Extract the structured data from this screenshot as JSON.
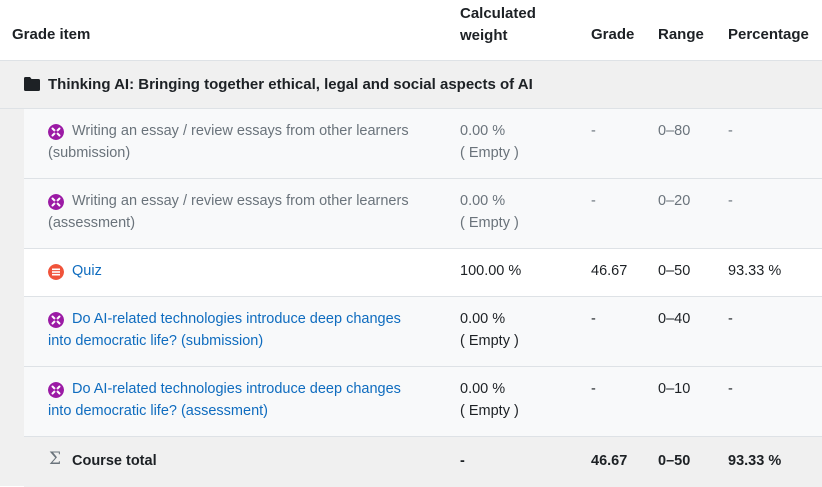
{
  "headers": {
    "grade_item": "Grade item",
    "calc_weight_line1": "Calculated",
    "calc_weight_line2": "weight",
    "grade": "Grade",
    "range": "Range",
    "percentage": "Percentage"
  },
  "category": {
    "icon": "folder-icon",
    "name": "Thinking AI: Bringing together ethical, legal and social aspects of AI"
  },
  "items": [
    {
      "icon": "workshop-icon",
      "name_line1": "Writing an essay / review essays from other learners",
      "name_line2": "(submission)",
      "weight": "0.00 %",
      "weight_note": "( Empty )",
      "grade": "-",
      "range": "0–80",
      "percentage": "-"
    },
    {
      "icon": "workshop-icon",
      "name_line1": "Writing an essay / review essays from other learners",
      "name_line2": "(assessment)",
      "weight": "0.00 %",
      "weight_note": "( Empty )",
      "grade": "-",
      "range": "0–20",
      "percentage": "-"
    },
    {
      "icon": "quiz-icon",
      "name_line1": "Quiz",
      "weight": "100.00 %",
      "grade": "46.67",
      "range": "0–50",
      "percentage": "93.33 %"
    },
    {
      "icon": "workshop-icon",
      "name_line1": "Do AI-related technologies introduce deep changes",
      "name_line2": "into democratic life? (submission)",
      "weight": "0.00 %",
      "weight_note": "( Empty )",
      "grade": "-",
      "range": "0–40",
      "percentage": "-"
    },
    {
      "icon": "workshop-icon",
      "name_line1": "Do AI-related technologies introduce deep changes",
      "name_line2": "into democratic life? (assessment)",
      "weight": "0.00 %",
      "weight_note": "( Empty )",
      "grade": "-",
      "range": "0–10",
      "percentage": "-"
    }
  ],
  "total": {
    "icon": "sigma-icon",
    "label": "Course total",
    "weight": "-",
    "grade": "46.67",
    "range": "0–50",
    "percentage": "93.33 %"
  },
  "colors": {
    "workshop_icon": "#9b1aa5",
    "quiz_icon": "#f0533a",
    "link": "#0f6cbf",
    "muted_text": "#6a737b"
  }
}
